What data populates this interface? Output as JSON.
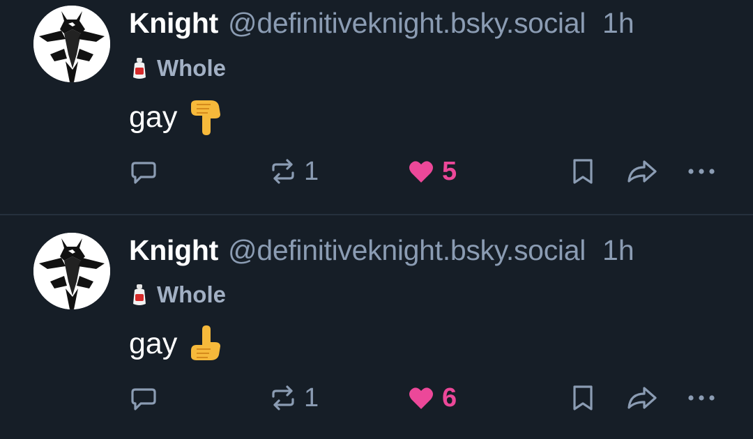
{
  "posts": [
    {
      "author_name": "Knight",
      "author_handle": "@definitiveknight.bsky.social",
      "time": "1h",
      "tag_label": "Whole",
      "text": "gay",
      "emoji": "pointing-down",
      "repost_count": "1",
      "like_count": "5"
    },
    {
      "author_name": "Knight",
      "author_handle": "@definitiveknight.bsky.social",
      "time": "1h",
      "tag_label": "Whole",
      "text": "gay",
      "emoji": "pointing-up",
      "repost_count": "1",
      "like_count": "6"
    }
  ],
  "icons": {
    "reply": "speech-bubble-icon",
    "repost": "repost-icon",
    "like": "heart-icon",
    "bookmark": "bookmark-icon",
    "share": "share-icon",
    "more": "more-dots-icon",
    "tag": "bottle-icon"
  },
  "colors": {
    "background": "#161e27",
    "name": "#ffffff",
    "muted": "#8b9cb3",
    "like": "#ec4899",
    "divider": "#25303d"
  }
}
